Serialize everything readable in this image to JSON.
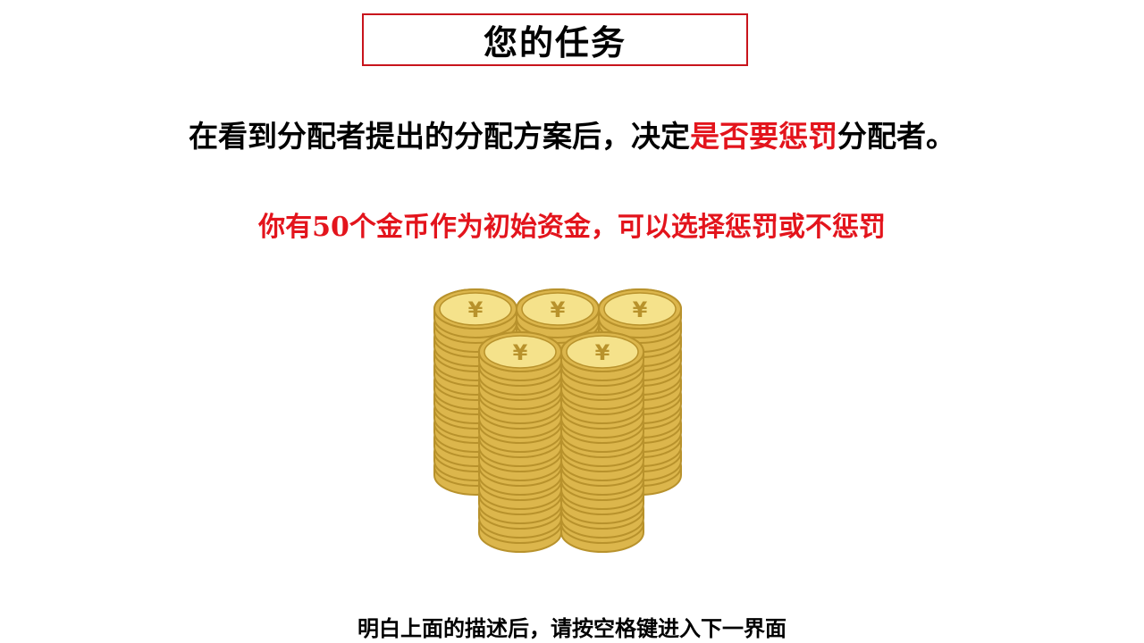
{
  "title": "您的任务",
  "instruction": {
    "part1": "在看到分配者提出的分配方案后，决定",
    "highlight": "是否要惩罚",
    "part2": "分配者。"
  },
  "funds_note": "你有50个金币作为初始资金，可以选择惩罚或不惩罚",
  "coins_illustration": {
    "icon": "coin-stacks-icon",
    "symbol": "¥",
    "colors": {
      "top": "#f5e28b",
      "side": "#dcb64c",
      "outline": "#b8922c"
    }
  },
  "footer": "明白上面的描述后，请按空格键进入下一界面",
  "colors": {
    "accent_red": "#e3141c",
    "box_border": "#c8141c"
  }
}
